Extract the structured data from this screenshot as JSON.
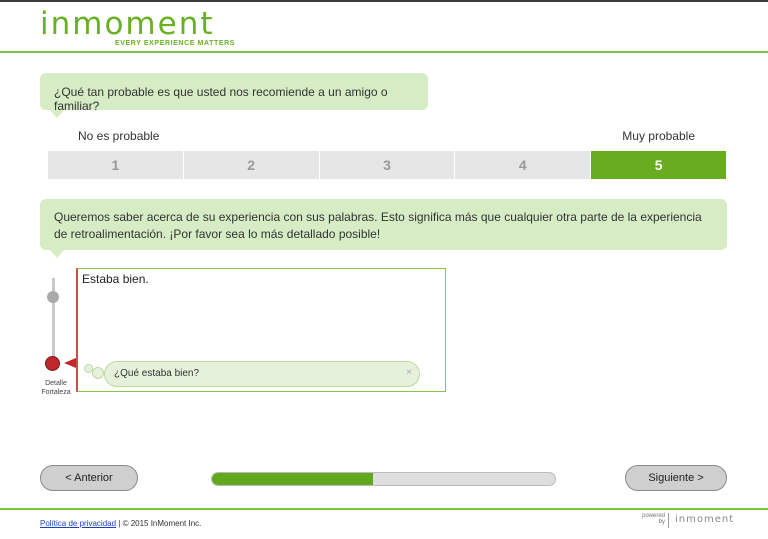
{
  "header": {
    "logo_text": "inmoment",
    "tagline": "EVERY EXPERIENCE MATTERS"
  },
  "question1": {
    "text": "¿Qué tan probable es que usted nos recomiende a un amigo o familiar?",
    "low_label": "No es probable",
    "high_label": "Muy probable",
    "options": [
      "1",
      "2",
      "3",
      "4",
      "5"
    ],
    "selected": "5"
  },
  "question2": {
    "text": "Queremos saber acerca de su experiencia con sus palabras. Esto significa más que cualquier otra parte de la experiencia de retroalimentación. ¡Por favor sea lo más detallado posible!",
    "comment_value": "Estaba bien.",
    "prompt_text": "¿Qué estaba bien?",
    "prompt_close": "×",
    "slider_label_1": "Detalle",
    "slider_label_2": "Fortaleza"
  },
  "navigation": {
    "prev_label": "< Anterior",
    "next_label": "Siguiente >",
    "progress": 0.47
  },
  "footer": {
    "privacy_link": "Política de privacidad",
    "copyright": " | © 2015 InMoment Inc.",
    "powered_line1": "powered",
    "powered_line2": "by",
    "powered_brand": "inmoment"
  },
  "colors": {
    "brand_green": "#6ab023",
    "selected_green": "#68ad1f",
    "bubble_green": "#d6ecc4",
    "alert_red": "#c0282d"
  }
}
